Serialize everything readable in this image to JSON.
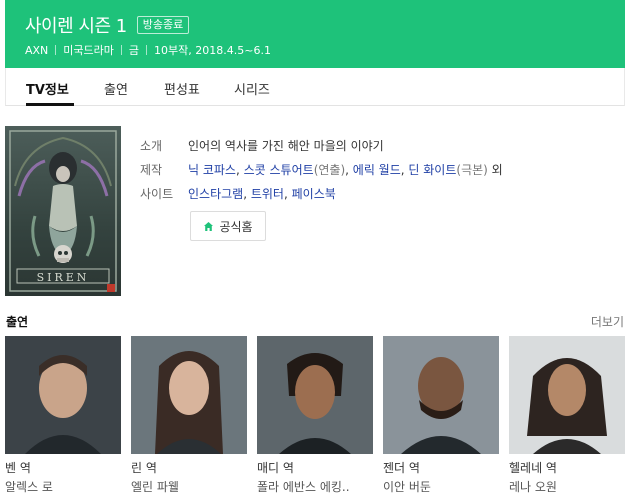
{
  "header": {
    "title": "사이렌 시즌 1",
    "status_badge": "방송종료",
    "channel": "AXN",
    "genre": "미국드라마",
    "day": "금",
    "episodes_dates": "10부작, 2018.4.5~6.1",
    "background_color": "#1ec27a"
  },
  "tabs": [
    {
      "label": "TV정보",
      "active": true
    },
    {
      "label": "출연",
      "active": false
    },
    {
      "label": "편성표",
      "active": false
    },
    {
      "label": "시리즈",
      "active": false
    }
  ],
  "poster": {
    "text": "SIREN"
  },
  "info": {
    "synopsis_label": "소개",
    "synopsis": "인어의 역사를 가진 해안 마을의 이야기",
    "production_label": "제작",
    "production": {
      "p1": "닉 코파스",
      "sep1": ", ",
      "p2": "스콧 스튜어트",
      "n2": "(연출)",
      "sep2": ", ",
      "p3": "에릭 월드",
      "sep3": ", ",
      "p4": "딘 화이트",
      "n4": "(극본)",
      "tail": " 외"
    },
    "site_label": "사이트",
    "sites": {
      "s1": "인스타그램",
      "sep1": ", ",
      "s2": "트위터",
      "sep2": ", ",
      "s3": "페이스북"
    }
  },
  "home_button": {
    "label": "공식홈",
    "icon": "home-icon"
  },
  "cast": {
    "title": "출연",
    "more_label": "더보기",
    "members": [
      {
        "role": "벤 역",
        "actor": "알렉스 로"
      },
      {
        "role": "린 역",
        "actor": "엘린 파웰"
      },
      {
        "role": "매디 역",
        "actor": "폴라 에반스 에킹.."
      },
      {
        "role": "젠더 역",
        "actor": "이안 버둔"
      },
      {
        "role": "헬레네 역",
        "actor": "레나 오원"
      }
    ]
  }
}
